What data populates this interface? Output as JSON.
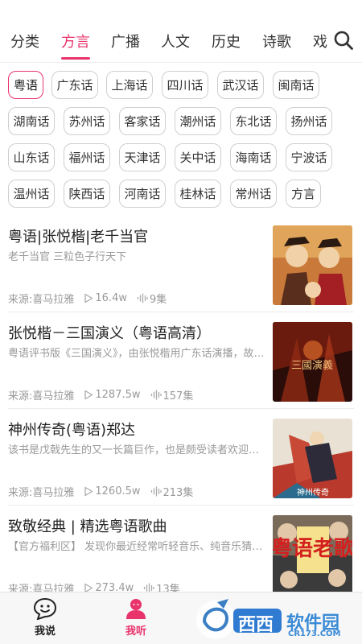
{
  "tabs": [
    {
      "label": "分类",
      "active": false
    },
    {
      "label": "方言",
      "active": true
    },
    {
      "label": "广播",
      "active": false
    },
    {
      "label": "人文",
      "active": false
    },
    {
      "label": "历史",
      "active": false
    },
    {
      "label": "诗歌",
      "active": false
    },
    {
      "label": "戏",
      "active": false
    }
  ],
  "dialects": [
    {
      "label": "粤语",
      "active": true
    },
    {
      "label": "广东话"
    },
    {
      "label": "上海话"
    },
    {
      "label": "四川话"
    },
    {
      "label": "武汉话"
    },
    {
      "label": "闽南话"
    },
    {
      "label": "湖南话"
    },
    {
      "label": "苏州话"
    },
    {
      "label": "客家话"
    },
    {
      "label": "潮州话"
    },
    {
      "label": "东北话"
    },
    {
      "label": "扬州话"
    },
    {
      "label": "山东话"
    },
    {
      "label": "福州话"
    },
    {
      "label": "天津话"
    },
    {
      "label": "关中话"
    },
    {
      "label": "海南话"
    },
    {
      "label": "宁波话"
    },
    {
      "label": "温州话"
    },
    {
      "label": "陕西话"
    },
    {
      "label": "河南话"
    },
    {
      "label": "桂林话"
    },
    {
      "label": "常州话"
    },
    {
      "label": "方言"
    }
  ],
  "items": [
    {
      "title": "粤语|张悦楷|老千当官",
      "desc": "老千当官 三粒色子行天下",
      "source": "来源:喜马拉雅",
      "plays": "16.4w",
      "episodes": "9集"
    },
    {
      "title": "张悦楷－三国演义（粤语高清）",
      "desc": "粤语评书版《三国演义》，由张悦楷用广东话演播，故事…",
      "source": "来源:喜马拉雅",
      "plays": "1287.5w",
      "episodes": "157集",
      "thumb_text": "三國演義"
    },
    {
      "title": "神州传奇(粤语)郑达",
      "desc": "该书是戊戟先生的又一长篇巨作，也是颇受读者欢迎的…",
      "source": "来源:喜马拉雅",
      "plays": "1260.5w",
      "episodes": "213集",
      "thumb_text": "神州传奇"
    },
    {
      "title": "致敬经典 | 精选粤语歌曲",
      "desc": "【官方福利区】 发现你最近经常听轻音乐、纯音乐猜…",
      "source": "来源:喜马拉雅",
      "plays": "273.4w",
      "episodes": "13集",
      "thumb_text": "粤语老歌"
    }
  ],
  "nav": [
    {
      "label": "我说",
      "active": false
    },
    {
      "label": "我听",
      "active": true
    }
  ],
  "watermark": {
    "main": "西西",
    "sub": "软件园",
    "url": "CR173.COM"
  },
  "colors": {
    "accent": "#e8336b"
  }
}
